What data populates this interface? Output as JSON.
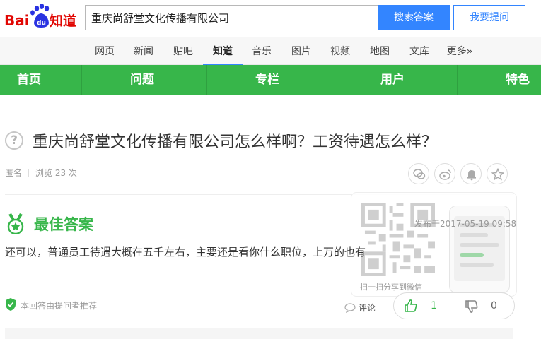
{
  "header": {
    "logo_text": "Bai du 知道",
    "search_value": "重庆尚舒堂文化传播有限公司",
    "search_button": "搜索答案",
    "ask_button": "我要提问"
  },
  "channels": [
    {
      "label": "网页"
    },
    {
      "label": "新闻"
    },
    {
      "label": "贴吧"
    },
    {
      "label": "知道",
      "active": true
    },
    {
      "label": "音乐"
    },
    {
      "label": "图片"
    },
    {
      "label": "视频"
    },
    {
      "label": "地图"
    },
    {
      "label": "文库"
    },
    {
      "label": "更多»"
    }
  ],
  "green_menu": [
    "首页",
    "问题",
    "专栏",
    "用户",
    "特色"
  ],
  "question": {
    "title": "重庆尚舒堂文化传播有限公司怎么样啊？工资待遇怎么样？",
    "asker": "匿名",
    "views": "浏览 23 次",
    "share_icons": [
      "wechat-icon",
      "weibo-icon",
      "bell-icon",
      "star-icon"
    ]
  },
  "answer": {
    "label": "最佳答案",
    "time": "发布于2017-05-19 09:58",
    "text": "还可以，普通员工待遇大概在五千左右，主要还是看你什么职位，上万的也有",
    "recommend": "本回答由提问者推荐",
    "comment": "评论",
    "upvotes": "1",
    "downvotes": "0",
    "qr_caption": "扫一扫分享到微信"
  },
  "colors": {
    "accent_blue": "#3385ff",
    "brand_green": "#37b64a",
    "logo_red": "#e10602"
  }
}
